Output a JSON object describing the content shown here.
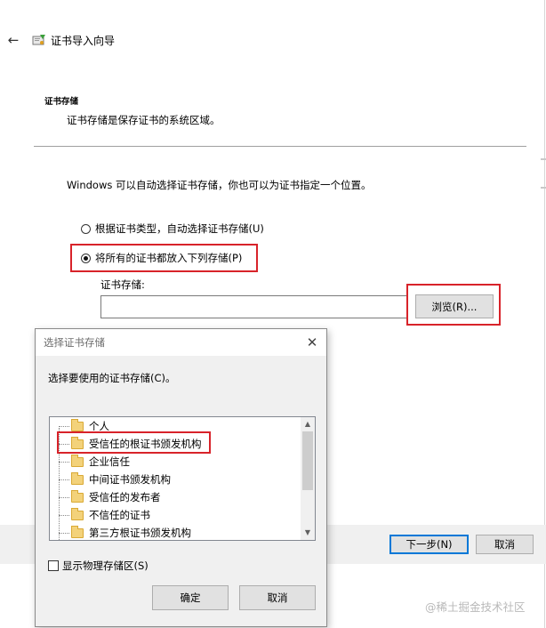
{
  "wizard": {
    "title": "证书导入向导",
    "section_title": "证书存储",
    "section_subtitle": "证书存储是保存证书的系统区域。",
    "description": "Windows 可以自动选择证书存储，你也可以为证书指定一个位置。",
    "option_auto_label": "根据证书类型，自动选择证书存储(U)",
    "option_manual_label": "将所有的证书都放入下列存储(P)",
    "selected_option": "manual",
    "store_label": "证书存储:",
    "store_value": "",
    "browse_label": "浏览(R)...",
    "next_label": "下一步(N)",
    "cancel_label": "取消"
  },
  "dialog": {
    "title": "选择证书存储",
    "prompt": "选择要使用的证书存储(C)。",
    "items": [
      {
        "label": "个人"
      },
      {
        "label": "受信任的根证书颁发机构"
      },
      {
        "label": "企业信任"
      },
      {
        "label": "中间证书颁发机构"
      },
      {
        "label": "受信任的发布者"
      },
      {
        "label": "不信任的证书"
      },
      {
        "label": "第三方根证书颁发机构"
      }
    ],
    "highlighted_item": "受信任的根证书颁发机构",
    "show_physical_label": "显示物理存储区(S)",
    "show_physical_checked": false,
    "ok_label": "确定",
    "cancel_label": "取消"
  },
  "watermark": "@稀土掘金技术社区",
  "colors": {
    "highlight_red": "#d8232a",
    "accent_blue": "#0078d7"
  }
}
